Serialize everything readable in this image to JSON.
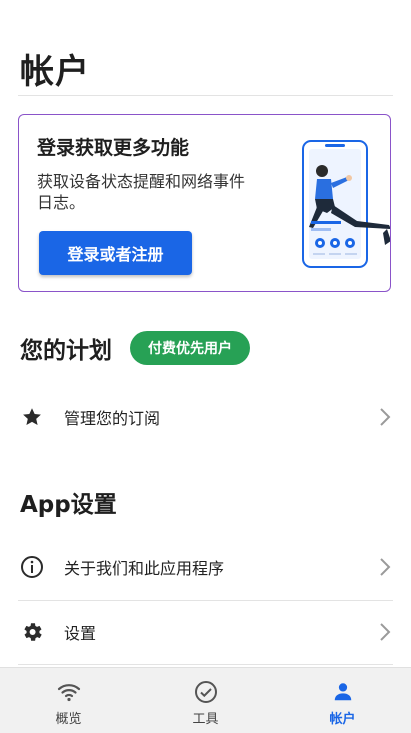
{
  "header": {
    "title": "帐户"
  },
  "promo": {
    "title": "登录获取更多功能",
    "description": "获取设备状态提醒和网络事件日志。",
    "login_button": "登录或者注册"
  },
  "plan": {
    "title": "您的计划",
    "badge": "付费优先用户",
    "items": [
      {
        "label": "管理您的订阅",
        "icon": "star-icon"
      }
    ]
  },
  "app_settings": {
    "title": "App设置",
    "items": [
      {
        "label": "关于我们和此应用程序",
        "icon": "info-icon"
      },
      {
        "label": "设置",
        "icon": "gear-icon"
      }
    ]
  },
  "bottom_nav": {
    "items": [
      {
        "label": "概览",
        "icon": "wifi-icon",
        "active": false
      },
      {
        "label": "工具",
        "icon": "check-circle-icon",
        "active": false
      },
      {
        "label": "帐户",
        "icon": "person-icon",
        "active": true
      }
    ]
  },
  "colors": {
    "accent_blue": "#1a66e6",
    "badge_green": "#27a155",
    "card_border_purple": "#8a53c9"
  }
}
